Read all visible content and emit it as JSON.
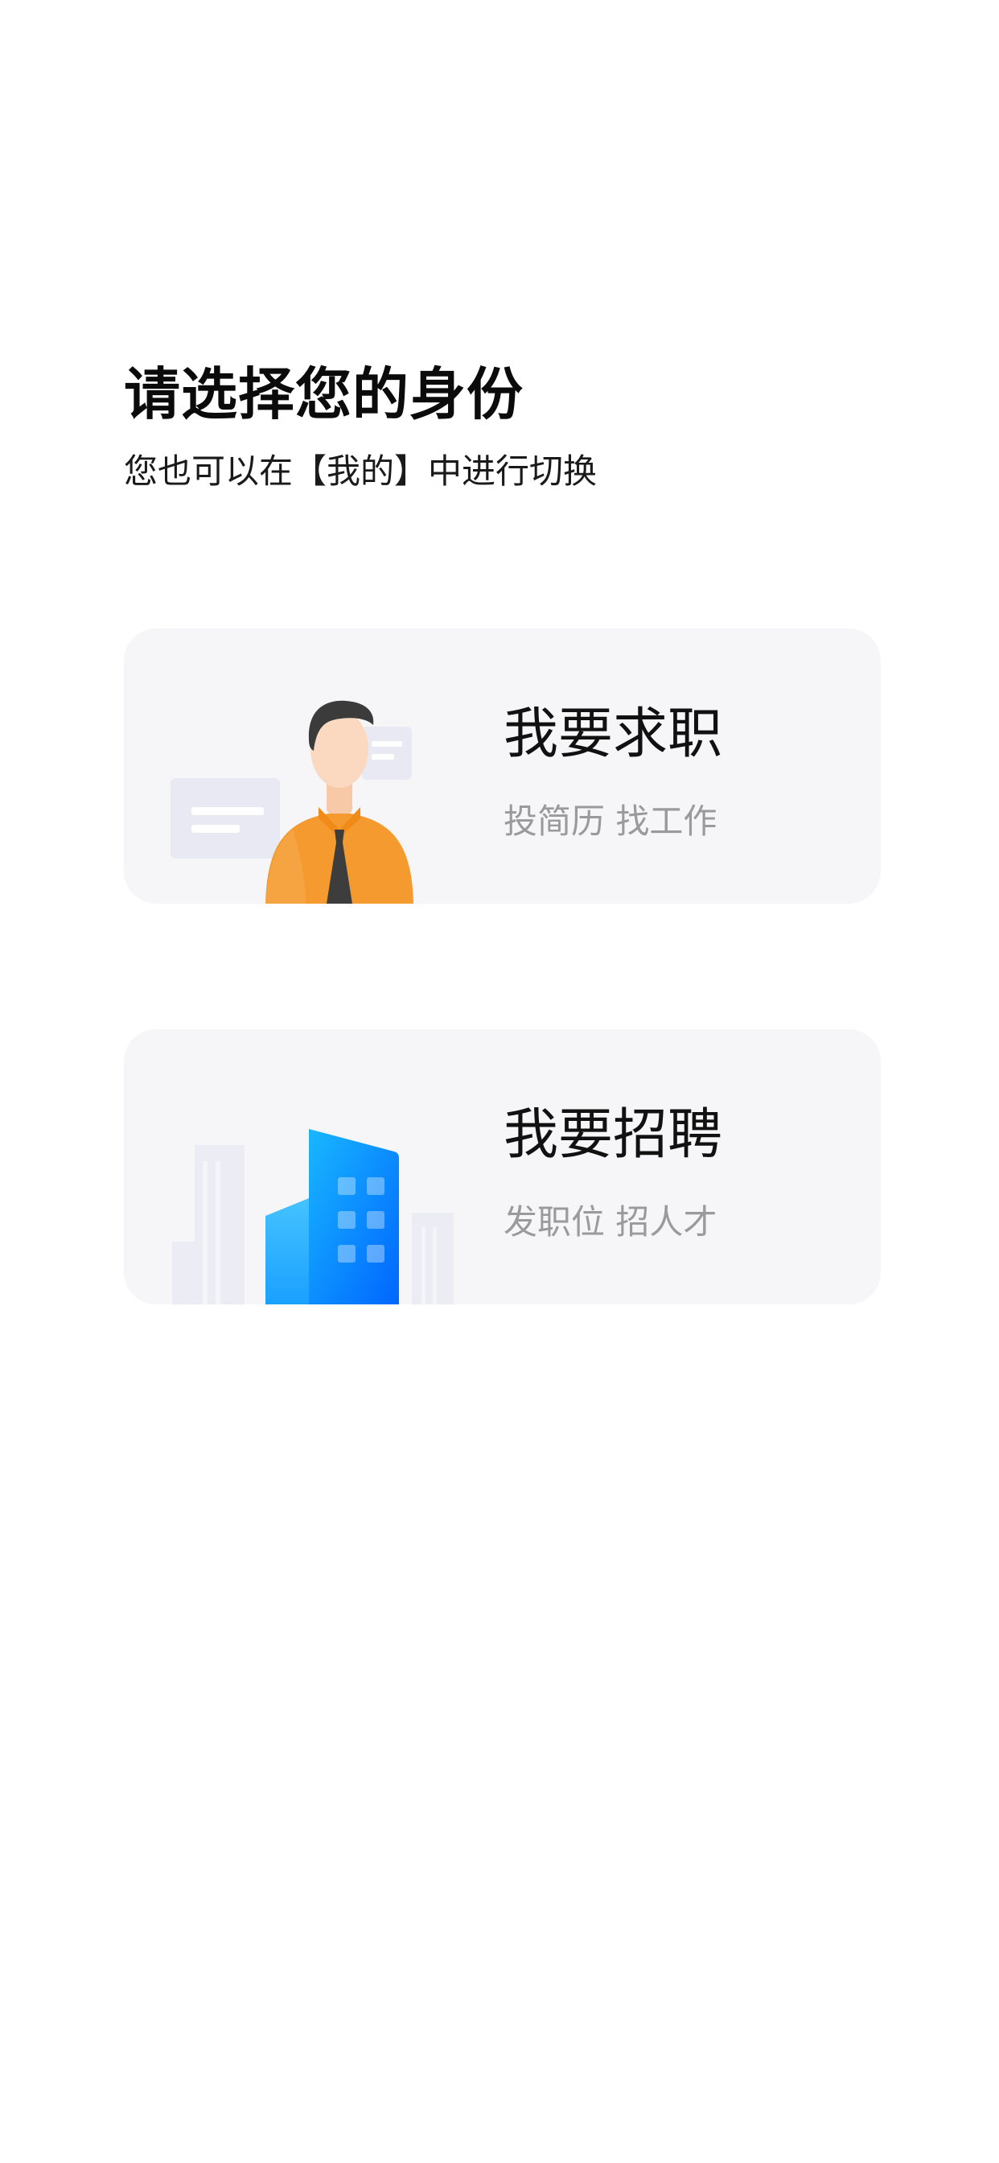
{
  "header": {
    "title": "请选择您的身份",
    "subtitle": "您也可以在【我的】中进行切换"
  },
  "roles": [
    {
      "title": "我要求职",
      "description": "投简历 找工作",
      "icon": "job-seeker-illustration",
      "accent": "#F7931E"
    },
    {
      "title": "我要招聘",
      "description": "发职位 招人才",
      "icon": "company-building-illustration",
      "accent": "#0A84FF"
    }
  ],
  "colors": {
    "background": "#FFFFFF",
    "card_background": "#F6F6F8",
    "title_text": "#111111",
    "secondary_text": "#9A9A9A"
  }
}
